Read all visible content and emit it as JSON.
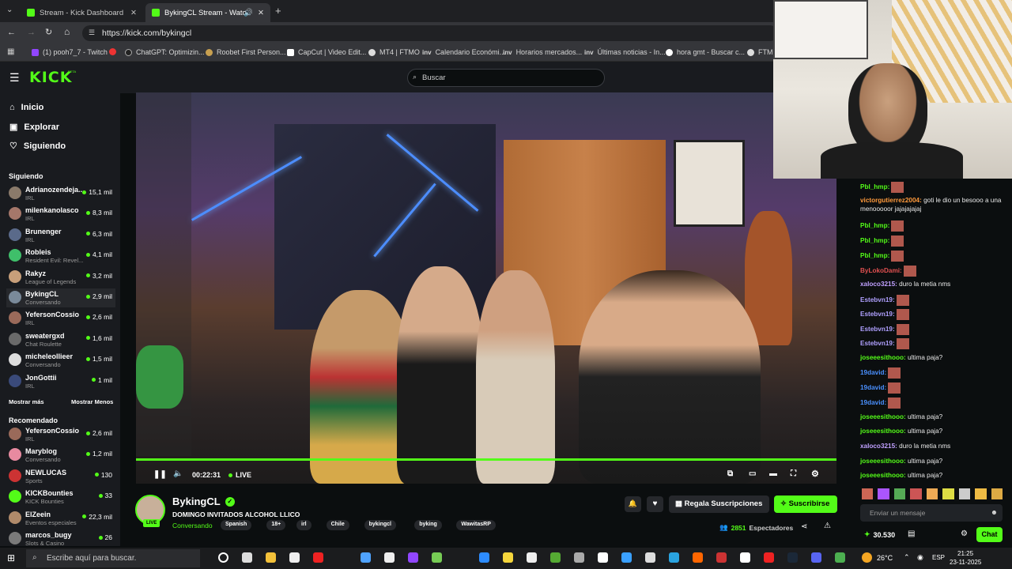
{
  "browser": {
    "tabs": [
      {
        "label": "Stream - Kick Dashboard"
      },
      {
        "label": "BykingCL Stream - Watch Li"
      }
    ],
    "url": "https://kick.com/bykingcl",
    "bookmarks": [
      {
        "label": "(1) pooh7_7 - Twitch"
      },
      {
        "label": "ChatGPT: Optimizin..."
      },
      {
        "label": "Roobet First Person..."
      },
      {
        "label": "CapCut | Video Edit..."
      },
      {
        "label": "MT4 | FTMO"
      },
      {
        "label": "Calendario Económi..."
      },
      {
        "label": "Horarios mercados..."
      },
      {
        "label": "Últimas noticias - In..."
      },
      {
        "label": "hora gmt - Buscar c..."
      },
      {
        "label": "FTMO"
      }
    ]
  },
  "header": {
    "logo": "KICK",
    "logo_badge": "BETA",
    "search_placeholder": "Buscar"
  },
  "sidebar": {
    "nav": [
      {
        "label": "Inicio",
        "icon": "home-icon"
      },
      {
        "label": "Explorar",
        "icon": "explore-icon"
      },
      {
        "label": "Siguiendo",
        "icon": "heart-icon"
      }
    ],
    "following_title": "Siguiendo",
    "following": [
      {
        "name": "Adrianozendeja...",
        "category": "IRL",
        "viewers": "15,1 mil",
        "color": "#8a7a6a"
      },
      {
        "name": "milenkanolasco",
        "category": "IRL",
        "viewers": "8,3 mil",
        "color": "#a5776a"
      },
      {
        "name": "Brunenger",
        "category": "IRL",
        "viewers": "6,3 mil",
        "color": "#5a6a8a"
      },
      {
        "name": "Robleis",
        "category": "Resident Evil: Revel...",
        "viewers": "4,1 mil",
        "color": "#3fbf6a"
      },
      {
        "name": "Rakyz",
        "category": "League of Legends",
        "viewers": "3,2 mil",
        "color": "#c79f7a"
      },
      {
        "name": "BykingCL",
        "category": "Conversando",
        "viewers": "2,9 mil",
        "color": "#7a8a9a"
      },
      {
        "name": "YefersonCossio",
        "category": "IRL",
        "viewers": "2,6 mil",
        "color": "#9a6a5a"
      },
      {
        "name": "sweatergxd",
        "category": "Chat Roulette",
        "viewers": "1,6 mil",
        "color": "#6a6a6a"
      },
      {
        "name": "micheleollieer",
        "category": "Conversando",
        "viewers": "1,5 mil",
        "color": "#ddd"
      },
      {
        "name": "JonGottii",
        "category": "IRL",
        "viewers": "1 mil",
        "color": "#3a4a7a"
      }
    ],
    "show_more": "Mostrar más",
    "show_less": "Mostrar Menos",
    "recommended_title": "Recomendado",
    "recommended": [
      {
        "name": "YefersonCossio",
        "category": "IRL",
        "viewers": "2,6 mil",
        "color": "#9a6a5a"
      },
      {
        "name": "Maryblog",
        "category": "Conversando",
        "viewers": "1,2 mil",
        "color": "#e88aa0"
      },
      {
        "name": "NEWLUCAS",
        "category": "Sports",
        "viewers": "130",
        "color": "#c33"
      },
      {
        "name": "KICKBounties",
        "category": "KICK Bounties",
        "viewers": "33",
        "color": "#53fc18"
      },
      {
        "name": "ElZeein",
        "category": "Eventos especiales",
        "viewers": "22,3 mil",
        "color": "#b08a6a"
      },
      {
        "name": "marcos_bugy",
        "category": "Slots & Casino",
        "viewers": "26",
        "color": "#7a7a7a"
      }
    ]
  },
  "player": {
    "time": "00:22:31",
    "live_label": "LIVE",
    "progress": 1.0
  },
  "stream": {
    "channel": "BykingCL",
    "title": "DOMINGO INVITADOS ALCOHOL LLICO",
    "category": "Conversando",
    "tags": [
      "Spanish",
      "18+",
      "irl",
      "Chile",
      "bykingcl",
      "byking",
      "WawitasRP"
    ],
    "live_badge": "LIVE",
    "gift_label": "Regala Suscripciones",
    "subscribe_label": "Suscribirse",
    "viewers": "2851",
    "viewers_label": "Espectadores"
  },
  "chat": {
    "messages": [
      {
        "user": "Pbl_hmp:",
        "color": "#53fc18",
        "text": "",
        "emote": true
      },
      {
        "user": "victorgutierrez2004:",
        "color": "#ff9a3c",
        "text": "goti le dio un besooo a una menooooor jajajajajaj",
        "emote": false
      },
      {
        "user": "Pbl_hmp:",
        "color": "#53fc18",
        "text": "",
        "emote": true
      },
      {
        "user": "Pbl_hmp:",
        "color": "#53fc18",
        "text": "",
        "emote": true
      },
      {
        "user": "Pbl_hmp:",
        "color": "#53fc18",
        "text": "",
        "emote": true
      },
      {
        "user": "ByLokoDami:",
        "color": "#e05050",
        "text": "",
        "emote": true
      },
      {
        "user": "xaloco3215:",
        "color": "#c0a0ff",
        "text": "duro la metia nms",
        "emote": false
      },
      {
        "user": "Estebvn19:",
        "color": "#b0a0ff",
        "text": "",
        "emote": true
      },
      {
        "user": "Estebvn19:",
        "color": "#b0a0ff",
        "text": "",
        "emote": true
      },
      {
        "user": "Estebvn19:",
        "color": "#b0a0ff",
        "text": "",
        "emote": true
      },
      {
        "user": "Estebvn19:",
        "color": "#b0a0ff",
        "text": "",
        "emote": true
      },
      {
        "user": "joseeesithooo:",
        "color": "#53fc18",
        "text": "ultima paja?",
        "emote": false
      },
      {
        "user": "19david:",
        "color": "#4a90ff",
        "text": "",
        "emote": true
      },
      {
        "user": "19david:",
        "color": "#4a90ff",
        "text": "",
        "emote": true
      },
      {
        "user": "19david:",
        "color": "#4a90ff",
        "text": "",
        "emote": true
      },
      {
        "user": "joseeesithooo:",
        "color": "#53fc18",
        "text": "ultima paja?",
        "emote": false
      },
      {
        "user": "joseeesithooo:",
        "color": "#53fc18",
        "text": "ultima paja?",
        "emote": false
      },
      {
        "user": "xaloco3215:",
        "color": "#c0a0ff",
        "text": "duro la metia nms",
        "emote": false
      },
      {
        "user": "joseeesithooo:",
        "color": "#53fc18",
        "text": "ultima paja?",
        "emote": false
      },
      {
        "user": "joseeesithooo:",
        "color": "#53fc18",
        "text": "ultima paja?",
        "emote": false
      }
    ],
    "input_placeholder": "Enviar un mensaje",
    "points": "30.530",
    "chat_button": "Chat"
  },
  "taskbar": {
    "search_placeholder": "Escribe aquí para buscar.",
    "weather": "26°C",
    "language": "ESP",
    "time": "21:25",
    "date": "23-11-2025"
  }
}
